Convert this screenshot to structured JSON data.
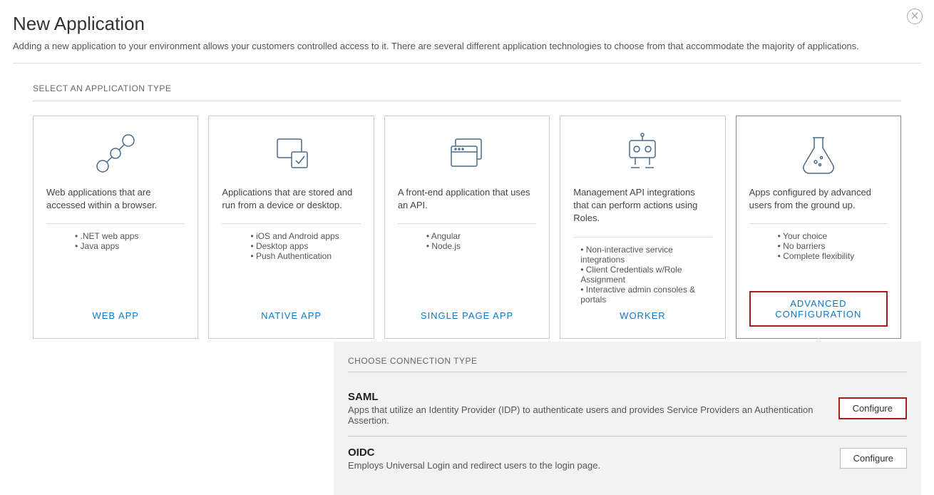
{
  "header": {
    "title": "New Application",
    "subtitle": "Adding a new application to your environment allows your customers controlled access to it. There are several different application technologies to choose from that accommodate the majority of applications."
  },
  "section_label": "SELECT AN APPLICATION TYPE",
  "cards": [
    {
      "icon": "network-icon",
      "desc": "Web applications that are accessed within a browser.",
      "bullets": [
        ".NET web apps",
        "Java apps"
      ],
      "button": "WEB APP"
    },
    {
      "icon": "device-check-icon",
      "desc": "Applications that are stored and run from a device or desktop.",
      "bullets": [
        "iOS and Android apps",
        "Desktop apps",
        "Push Authentication"
      ],
      "button": "NATIVE APP"
    },
    {
      "icon": "browser-windows-icon",
      "desc": "A front-end application that uses an API.",
      "bullets": [
        "Angular",
        "Node.js"
      ],
      "button": "SINGLE PAGE APP"
    },
    {
      "icon": "robot-icon",
      "desc": "Management API integrations that can perform actions using Roles.",
      "bullets": [
        "Non-interactive service integrations",
        "Client Credentials w/Role Assignment",
        "Interactive admin consoles & portals"
      ],
      "button": "WORKER"
    },
    {
      "icon": "flask-icon",
      "desc": "Apps configured by advanced users from the ground up.",
      "bullets": [
        "Your choice",
        "No barriers",
        "Complete flexibility"
      ],
      "button": "ADVANCED CONFIGURATION",
      "selected": true
    }
  ],
  "connection": {
    "label": "CHOOSE CONNECTION TYPE",
    "rows": [
      {
        "name": "SAML",
        "desc": "Apps that utilize an Identity Provider (IDP) to authenticate users and provides Service Providers an Authentication Assertion.",
        "button": "Configure",
        "highlighted": true
      },
      {
        "name": "OIDC",
        "desc": "Employs Universal Login and redirect users to the login page.",
        "button": "Configure",
        "highlighted": false
      }
    ]
  }
}
